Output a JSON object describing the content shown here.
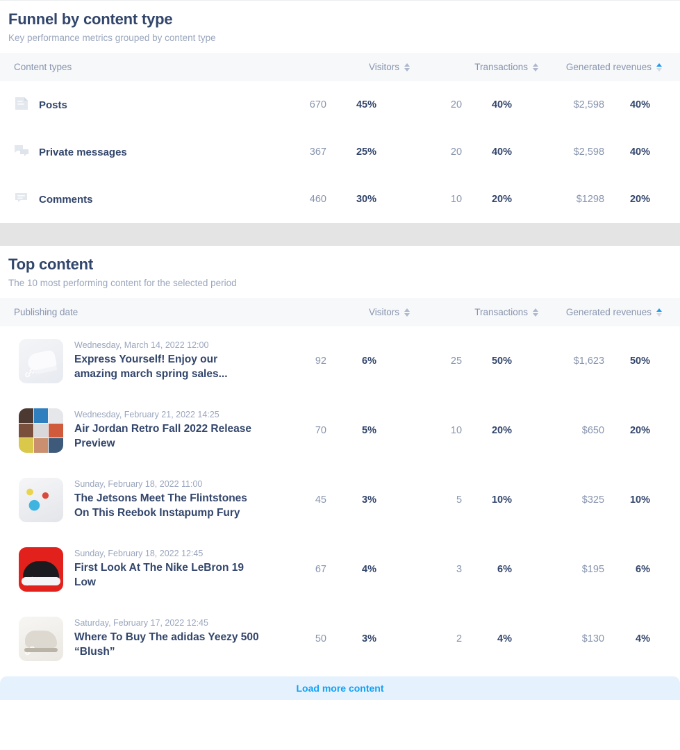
{
  "funnel": {
    "title": "Funnel by content type",
    "subtitle": "Key performance metrics grouped by content type",
    "columns": {
      "name": "Content types",
      "visitors": "Visitors",
      "transactions": "Transactions",
      "revenues": "Generated revenues"
    },
    "sort": {
      "visitors": "sort-icon",
      "transactions": "sort-icon",
      "revenues": "sort-icon-active-ascending"
    },
    "rows": [
      {
        "icon": "post-icon",
        "label": "Posts",
        "visitors": "670",
        "visitors_pct": "45%",
        "transactions": "20",
        "transactions_pct": "40%",
        "revenues": "$2,598",
        "revenues_pct": "40%"
      },
      {
        "icon": "private-message-icon",
        "label": "Private messages",
        "visitors": "367",
        "visitors_pct": "25%",
        "transactions": "20",
        "transactions_pct": "40%",
        "revenues": "$2,598",
        "revenues_pct": "40%"
      },
      {
        "icon": "comment-icon",
        "label": "Comments",
        "visitors": "460",
        "visitors_pct": "30%",
        "transactions": "10",
        "transactions_pct": "20%",
        "revenues": "$1298",
        "revenues_pct": "20%"
      }
    ]
  },
  "top_content": {
    "title": "Top content",
    "subtitle": "The 10 most performing content for the selected period",
    "columns": {
      "name": "Publishing date",
      "visitors": "Visitors",
      "transactions": "Transactions",
      "revenues": "Generated revenues"
    },
    "rows": [
      {
        "thumb": "white-sneaker-photo",
        "has_link_badge": true,
        "date": "Wednesday, March 14, 2022 12:00",
        "title": "Express Yourself! Enjoy our amazing march spring sales...",
        "visitors": "92",
        "visitors_pct": "6%",
        "transactions": "25",
        "transactions_pct": "50%",
        "revenues": "$1,623",
        "revenues_pct": "50%"
      },
      {
        "thumb": "sneaker-grid-collage",
        "has_link_badge": false,
        "date": "Wednesday, February 21, 2022 14:25",
        "title": "Air Jordan Retro Fall 2022 Release Preview",
        "visitors": "70",
        "visitors_pct": "5%",
        "transactions": "10",
        "transactions_pct": "20%",
        "revenues": "$650",
        "revenues_pct": "20%"
      },
      {
        "thumb": "reebok-instapump-photo",
        "has_link_badge": false,
        "date": "Sunday, February 18, 2022 11:00",
        "title": "The Jetsons Meet The Flintstones On This Reebok Instapump Fury",
        "visitors": "45",
        "visitors_pct": "3%",
        "transactions": "5",
        "transactions_pct": "10%",
        "revenues": "$325",
        "revenues_pct": "10%"
      },
      {
        "thumb": "nike-lebron-red-photo",
        "has_link_badge": true,
        "date": "Sunday, February 18, 2022 12:45",
        "title": "First Look At The Nike LeBron 19 Low",
        "visitors": "67",
        "visitors_pct": "4%",
        "transactions": "3",
        "transactions_pct": "6%",
        "revenues": "$195",
        "revenues_pct": "6%"
      },
      {
        "thumb": "adidas-yeezy-blush-photo",
        "has_link_badge": true,
        "date": "Saturday, February 17, 2022 12:45",
        "title": "Where To Buy The adidas Yeezy 500 “Blush”",
        "visitors": "50",
        "visitors_pct": "3%",
        "transactions": "2",
        "transactions_pct": "4%",
        "revenues": "$130",
        "revenues_pct": "4%"
      }
    ],
    "load_more_label": "Load more content"
  },
  "colors": {
    "heading": "#32456b",
    "muted": "#9aa6bd",
    "accent_blue": "#11a0f8",
    "sort_active": "#1e9bf0",
    "band_gray": "#e4e4e5",
    "load_more_bg": "#e5f2fd"
  }
}
